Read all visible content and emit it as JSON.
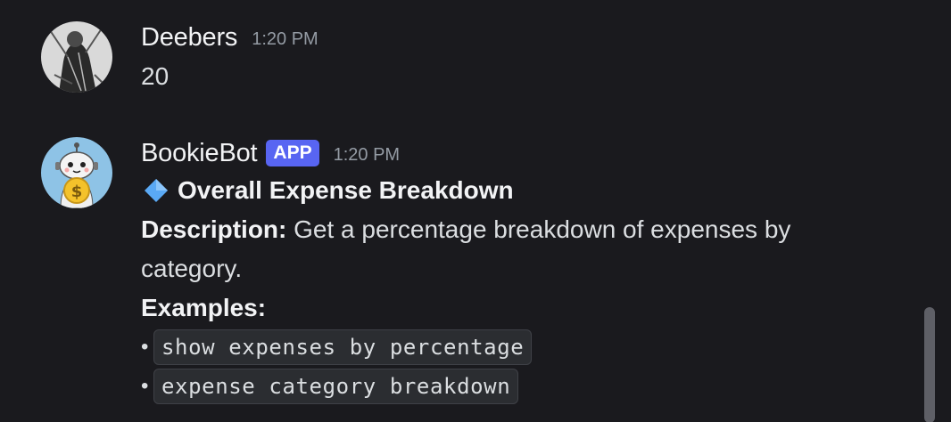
{
  "messages": [
    {
      "username": "Deebers",
      "timestamp": "1:20 PM",
      "text": "20",
      "avatar_icon": "user-portrait-avatar"
    },
    {
      "username": "BookieBot",
      "badge": "APP",
      "timestamp": "1:20 PM",
      "avatar_icon": "robot-coin-avatar",
      "embed": {
        "title_icon": "blue-diamond-icon",
        "title": "Overall Expense Breakdown",
        "description_label": "Description:",
        "description_text": " Get a percentage breakdown of expenses by category.",
        "examples_label": "Examples:",
        "examples": [
          "show expenses by percentage",
          "expense category breakdown"
        ]
      }
    }
  ],
  "colors": {
    "background": "#1a1a1e",
    "app_badge": "#5865f2",
    "diamond": "#5aa9f5"
  }
}
